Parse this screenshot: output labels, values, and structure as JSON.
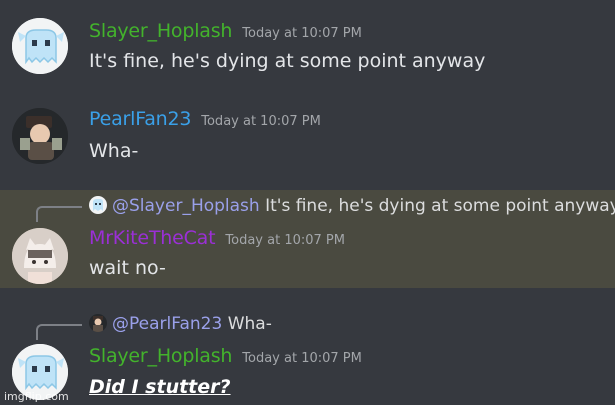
{
  "colors": {
    "background": "#36393f",
    "highlight": "#4a4a40",
    "slayer_name": "#43b32c",
    "pearl_name": "#3aa0e8",
    "kite_name": "#9b2fd6",
    "mention": "#9aa0ea"
  },
  "messages": [
    {
      "id": "m1",
      "username": "Slayer_Hoplash",
      "timestamp": "Today at 10:07 PM",
      "text": "It's fine, he's dying at some point anyway",
      "avatar_icon": "ghost-creature-avatar"
    },
    {
      "id": "m2",
      "username": "PearlFan23",
      "timestamp": "Today at 10:07 PM",
      "text": "Wha-",
      "avatar_icon": "character-avatar"
    },
    {
      "id": "m3",
      "reply_to": {
        "mention": "@Slayer_Hoplash",
        "text": "It's fine, he's dying at some point anyway"
      },
      "username": "MrKiteTheCat",
      "timestamp": "Today at 10:07 PM",
      "text": "wait no-",
      "avatar_icon": "cat-avatar"
    },
    {
      "id": "m4",
      "reply_to": {
        "mention": "@PearlFan23",
        "text": "Wha-"
      },
      "username": "Slayer_Hoplash",
      "timestamp": "Today at 10:07 PM",
      "text": "Did I stutter?",
      "avatar_icon": "ghost-creature-avatar"
    }
  ],
  "watermark": "imgflip.com"
}
